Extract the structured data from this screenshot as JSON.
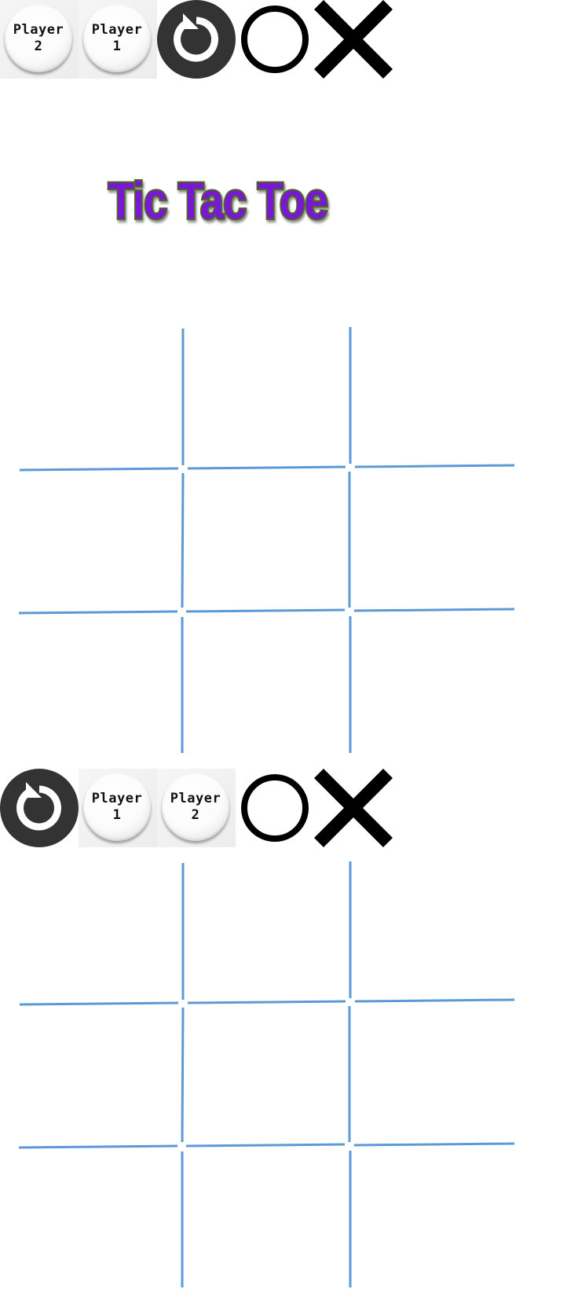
{
  "top_toolbar": {
    "player_left": {
      "line1": "Player",
      "line2": "2"
    },
    "player_right": {
      "line1": "Player",
      "line2": "1"
    },
    "restart_icon": "restart-icon",
    "o_icon": "o-mark-icon",
    "x_icon": "x-mark-icon"
  },
  "title": "Tic Tac Toe",
  "bottom_toolbar": {
    "restart_icon": "restart-icon",
    "player_left": {
      "line1": "Player",
      "line2": "1"
    },
    "player_right": {
      "line1": "Player",
      "line2": "2"
    },
    "o_icon": "o-mark-icon",
    "x_icon": "x-mark-icon"
  },
  "colors": {
    "grid_line": "#5b9bd5",
    "title_fill": "#7a16d6",
    "title_outline": "#4c6b1a",
    "restart_bg": "#333333"
  },
  "boards": [
    {
      "name": "board-1",
      "cells": [
        "",
        "",
        "",
        "",
        "",
        "",
        "",
        "",
        ""
      ]
    },
    {
      "name": "board-2",
      "cells": [
        "",
        "",
        "",
        "",
        "",
        "",
        "",
        "",
        ""
      ]
    }
  ]
}
